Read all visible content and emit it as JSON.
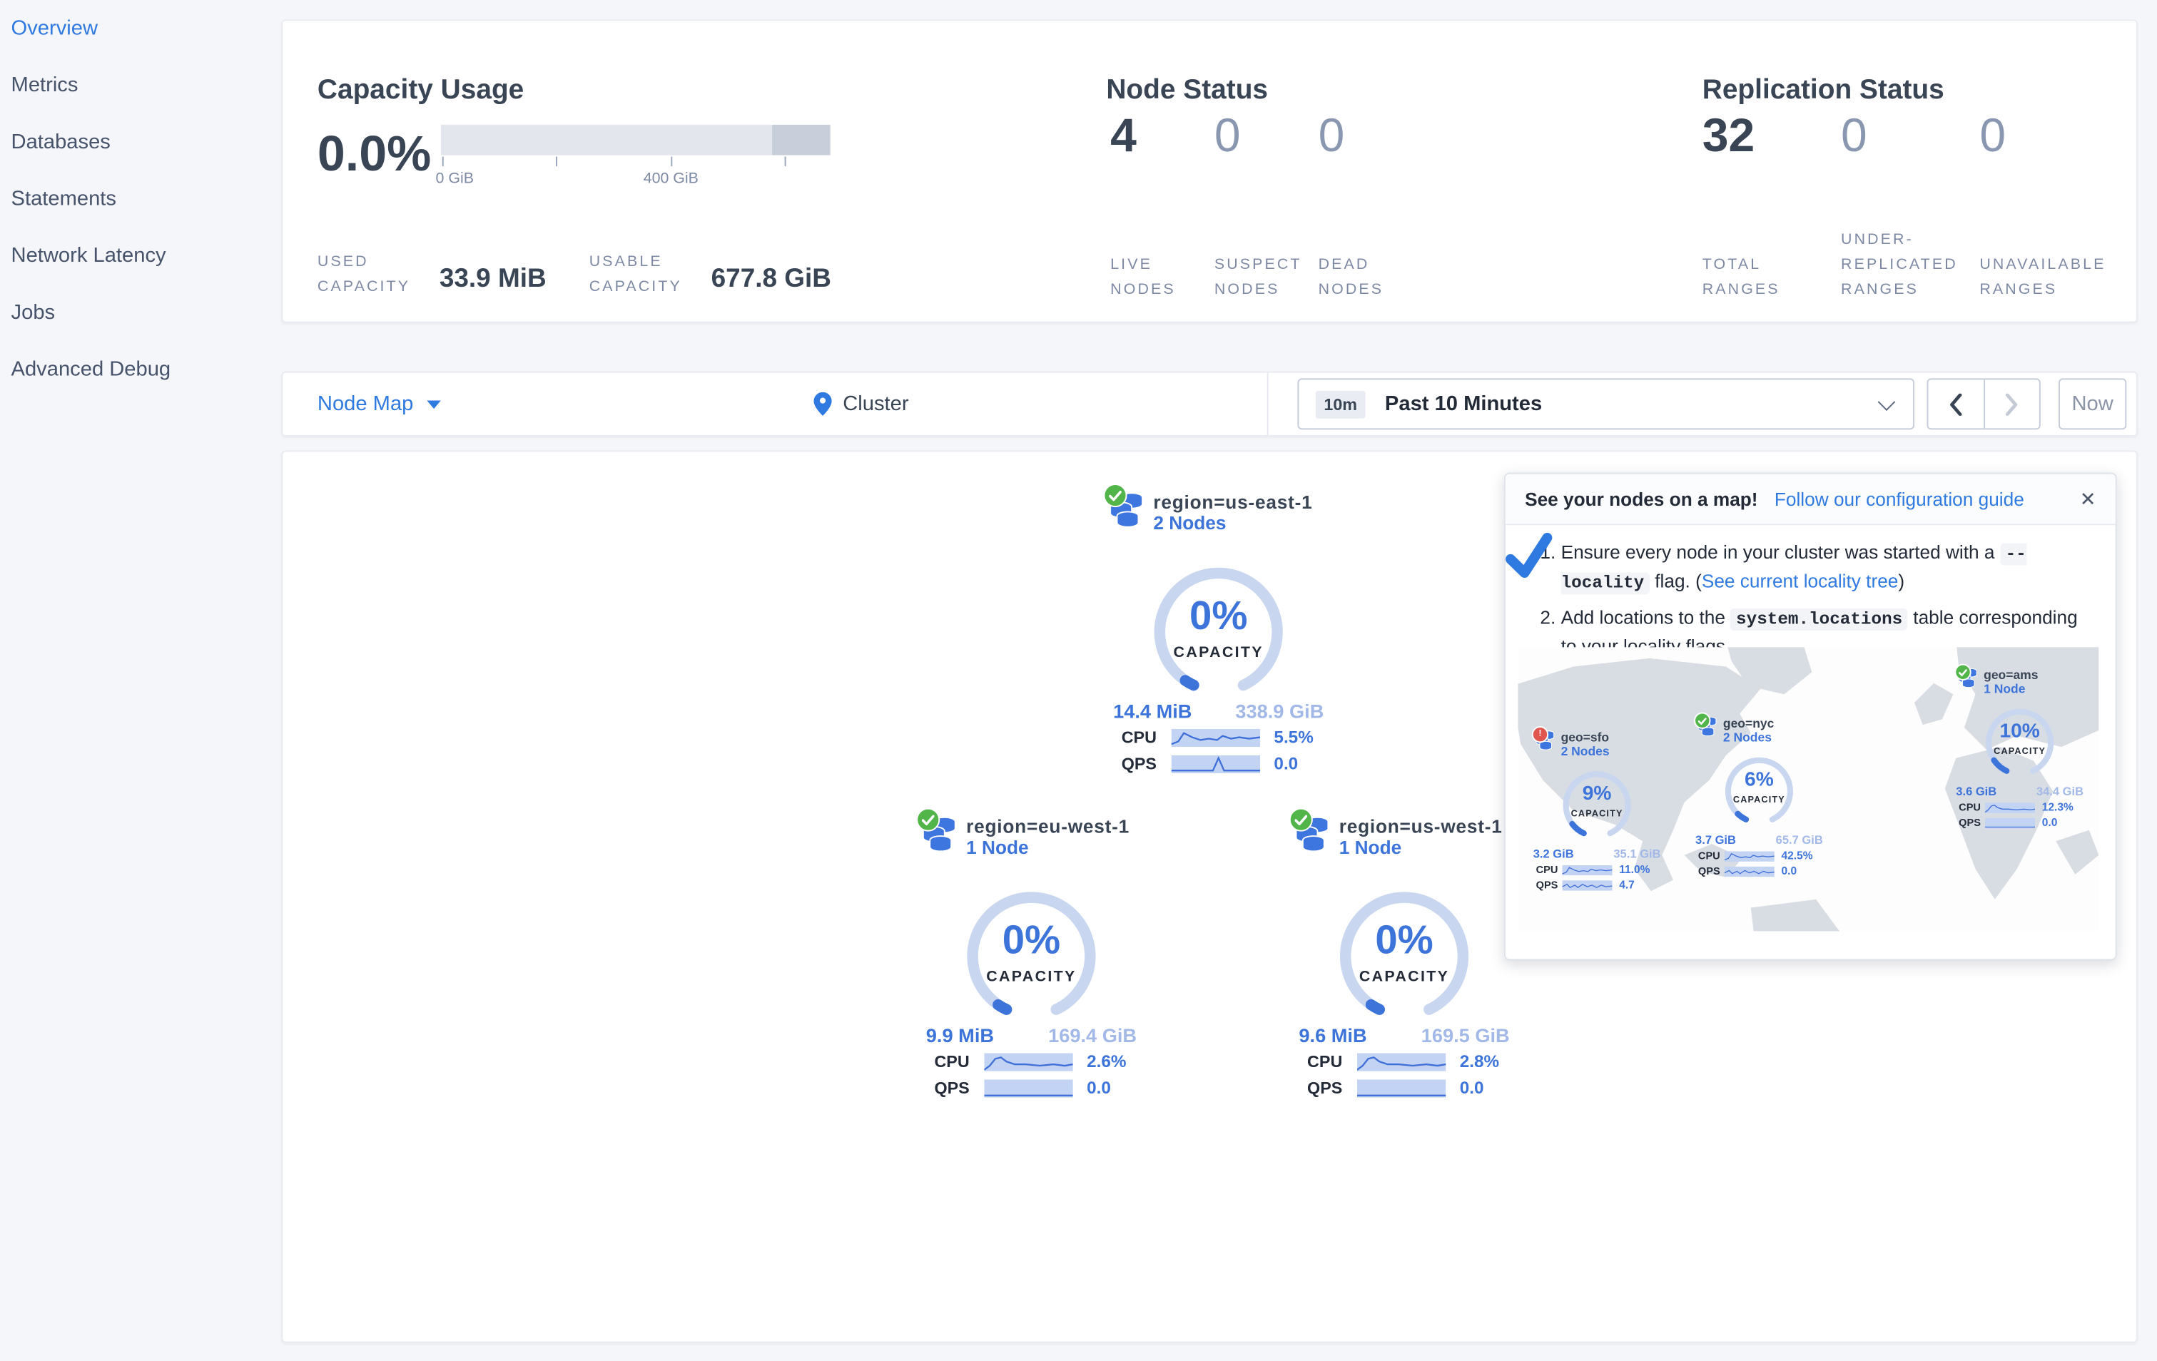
{
  "sidebar": {
    "items": [
      "Overview",
      "Metrics",
      "Databases",
      "Statements",
      "Network Latency",
      "Jobs",
      "Advanced Debug"
    ]
  },
  "summary": {
    "capacity": {
      "title": "Capacity Usage",
      "percent": "0.0%",
      "tick0": "0 GiB",
      "tick1": "400 GiB",
      "used_label": "USED CAPACITY",
      "used_value": "33.9 MiB",
      "usable_label": "USABLE CAPACITY",
      "usable_value": "677.8 GiB"
    },
    "nodes": {
      "title": "Node Status",
      "live_value": "4",
      "live_label": "LIVE NODES",
      "suspect_value": "0",
      "suspect_label": "SUSPECT NODES",
      "dead_value": "0",
      "dead_label": "DEAD NODES"
    },
    "replication": {
      "title": "Replication Status",
      "total_value": "32",
      "total_label": "TOTAL RANGES",
      "under_value": "0",
      "under_label": "UNDER-REPLICATED RANGES",
      "unavail_value": "0",
      "unavail_label": "UNAVAILABLE RANGES"
    }
  },
  "toolbar": {
    "view_label": "Node Map",
    "breadcrumb": "Cluster",
    "range_badge": "10m",
    "range_label": "Past 10 Minutes",
    "now_label": "Now"
  },
  "labels": {
    "cpu": "CPU",
    "qps": "QPS",
    "capacity": "CAPACITY"
  },
  "map": {
    "regions": [
      {
        "name": "region=us-east-1",
        "nodes": "2 Nodes",
        "percent": "0%",
        "used": "14.4 MiB",
        "usable": "338.9 GiB",
        "cpu": "5.5%",
        "qps": "0.0"
      },
      {
        "name": "region=eu-west-1",
        "nodes": "1 Node",
        "percent": "0%",
        "used": "9.9 MiB",
        "usable": "169.4 GiB",
        "cpu": "2.6%",
        "qps": "0.0"
      },
      {
        "name": "region=us-west-1",
        "nodes": "1 Node",
        "percent": "0%",
        "used": "9.6 MiB",
        "usable": "169.5 GiB",
        "cpu": "2.8%",
        "qps": "0.0"
      }
    ]
  },
  "popup": {
    "title": "See your nodes on a map!",
    "link": "Follow our configuration guide",
    "close_glyph": "✕",
    "warn_glyph": "!",
    "step1_pre": "Ensure every node in your cluster was started with a ",
    "step1_code": "--locality",
    "step1_mid": " flag. (",
    "step1_link": "See current locality tree",
    "step1_post": ")",
    "step2_pre": "Add locations to the ",
    "step2_code": "system.locations",
    "step2_post": " table corresponding to your locality flags.",
    "mini_regions": [
      {
        "name": "geo=sfo",
        "nodes": "2 Nodes",
        "percent": "9%",
        "used": "3.2 GiB",
        "usable": "35.1 GiB",
        "cpu": "11.0%",
        "qps": "4.7"
      },
      {
        "name": "geo=nyc",
        "nodes": "2 Nodes",
        "percent": "6%",
        "used": "3.7 GiB",
        "usable": "65.7 GiB",
        "cpu": "42.5%",
        "qps": "0.0"
      },
      {
        "name": "geo=ams",
        "nodes": "1 Node",
        "percent": "10%",
        "used": "3.6 GiB",
        "usable": "34.4 GiB",
        "cpu": "12.3%",
        "qps": "0.0"
      }
    ]
  },
  "colors": {
    "accent_blue": "#2f7ae0",
    "card_blue": "#3d74da",
    "ring": "#c9d6f0",
    "value_light": "#a2b9e8",
    "green": "#52b54a",
    "red": "#e0564f",
    "dark_text": "#394455",
    "label_gray": "#7d89a4"
  }
}
